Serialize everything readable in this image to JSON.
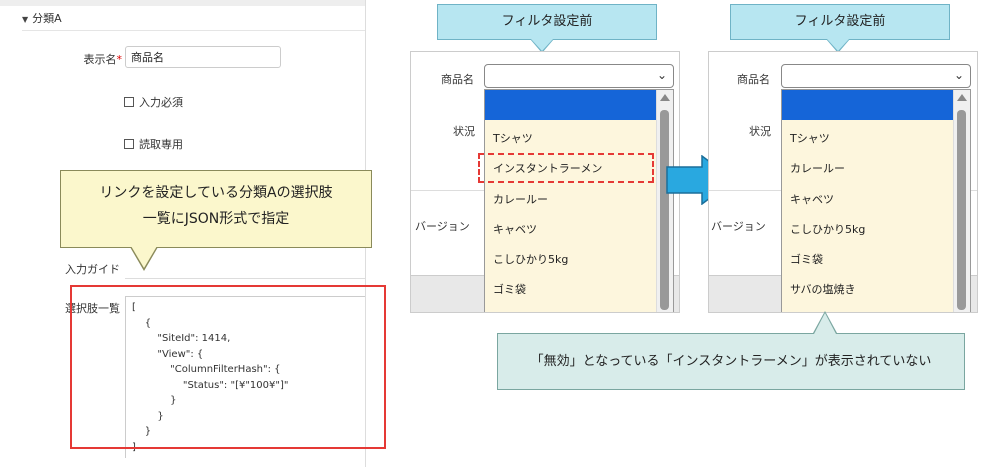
{
  "settings_panel": {
    "section_title": "分類A",
    "display_name_label": "表示名",
    "required_mark": "*",
    "display_name_value": "商品名",
    "input_required_label": "入力必須",
    "read_only_label": "読取専用",
    "input_guide_label": "入力ガイド",
    "choices_label": "選択肢一覧",
    "choices_json": "[\n    {\n        \"SiteId\": 1414,\n        \"View\": {\n            \"ColumnFilterHash\": {\n                \"Status\": \"[¥\"100¥\"]\"\n            }\n        }\n    }\n]"
  },
  "callout": {
    "line1": "リンクを設定している分類Aの選択肢",
    "line2": "一覧にJSON形式で指定"
  },
  "before_panel": {
    "banner": "フィルタ設定前",
    "product_label": "商品名",
    "status_label": "状況",
    "version_label": "バージョン",
    "options": [
      "Tシャツ",
      "インスタントラーメン",
      "カレールー",
      "キャベツ",
      "こしひかり5kg",
      "ゴミ袋"
    ]
  },
  "after_panel": {
    "banner": "フィルタ設定前",
    "product_label": "商品名",
    "status_label": "状況",
    "version_label": "バージョン",
    "options": [
      "Tシャツ",
      "カレールー",
      "キャベツ",
      "こしひかり5kg",
      "ゴミ袋",
      "サバの塩焼き"
    ]
  },
  "note": "「無効」となっている「インスタントラーメン」が表示されていない",
  "colors": {
    "highlight_blue": "#1565d8",
    "red_outline": "#e53935",
    "banner_blue": "#b7e6f1",
    "arrow_blue": "#29a8e0"
  }
}
